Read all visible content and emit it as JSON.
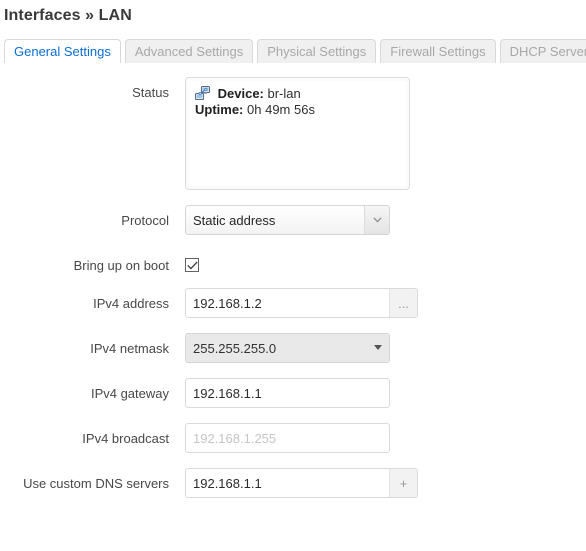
{
  "page": {
    "title": "Interfaces » LAN"
  },
  "tabs": [
    {
      "label": "General Settings",
      "active": true,
      "name": "tab-general-settings"
    },
    {
      "label": "Advanced Settings",
      "active": false,
      "name": "tab-advanced-settings"
    },
    {
      "label": "Physical Settings",
      "active": false,
      "name": "tab-physical-settings"
    },
    {
      "label": "Firewall Settings",
      "active": false,
      "name": "tab-firewall-settings"
    },
    {
      "label": "DHCP Server",
      "active": false,
      "name": "tab-dhcp-server"
    }
  ],
  "form": {
    "status": {
      "label": "Status",
      "icon": "network-device-icon",
      "device_label": "Device:",
      "device_value": "br-lan",
      "uptime_label": "Uptime:",
      "uptime_value": "0h 49m 56s"
    },
    "protocol": {
      "label": "Protocol",
      "value": "Static address",
      "options": [
        "Static address"
      ]
    },
    "bring_up_on_boot": {
      "label": "Bring up on boot",
      "checked": true,
      "check_glyph": "✓"
    },
    "ipv4_address": {
      "label": "IPv4 address",
      "value": "192.168.1.2",
      "button_label": "..."
    },
    "ipv4_netmask": {
      "label": "IPv4 netmask",
      "value": "255.255.255.0"
    },
    "ipv4_gateway": {
      "label": "IPv4 gateway",
      "value": "192.168.1.1"
    },
    "ipv4_broadcast": {
      "label": "IPv4 broadcast",
      "value": "",
      "placeholder": "192.168.1.255"
    },
    "custom_dns": {
      "label": "Use custom DNS servers",
      "value": "192.168.1.1",
      "button_label": "+"
    }
  },
  "colors": {
    "active_tab_text": "#0b6fd6",
    "inactive_tab_text": "#a8a8a8",
    "heading": "#3a3a3a",
    "netmask_field_bg": "#e9e9e9"
  }
}
